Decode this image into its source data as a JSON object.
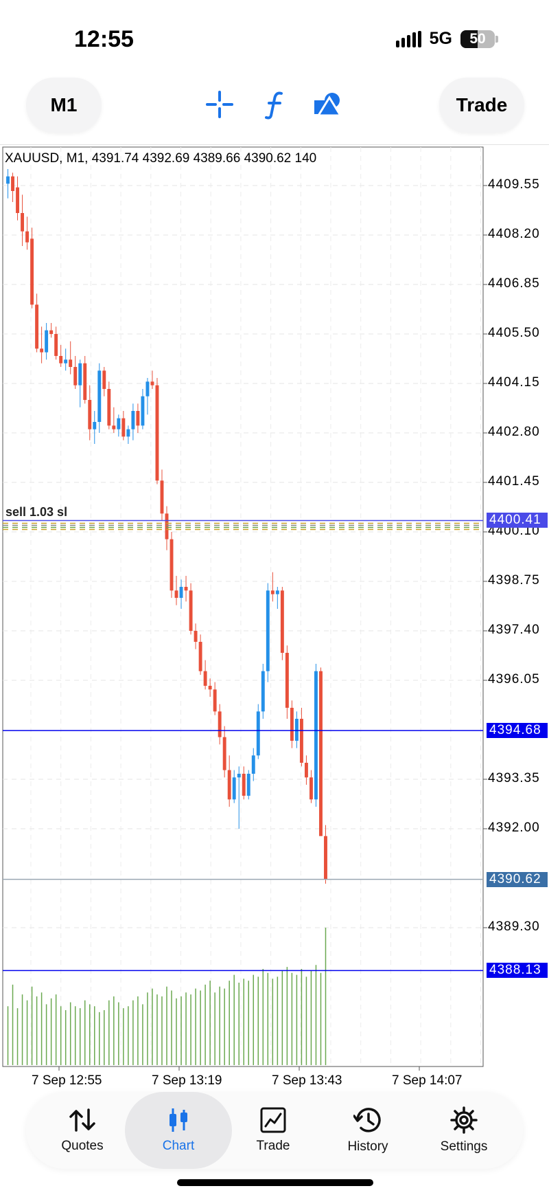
{
  "status_bar": {
    "time": "12:55",
    "network": "5G",
    "battery": "50",
    "battery_level": 0.5
  },
  "toolbar": {
    "timeframe": "M1",
    "trade_label": "Trade",
    "icons": [
      "crosshair-icon",
      "indicator-f-icon",
      "objects-icon"
    ]
  },
  "chart": {
    "header": "XAUUSD, M1, 4391.74 4392.69 4389.66 4390.62 140",
    "price_axis": [
      "4409.55",
      "4408.20",
      "4406.85",
      "4405.50",
      "4404.15",
      "4402.80",
      "4401.45",
      "4400.10",
      "4398.75",
      "4397.40",
      "4396.05",
      "4393.35",
      "4392.00",
      "4389.30"
    ],
    "time_axis": [
      "7 Sep 12:55",
      "7 Sep 13:19",
      "7 Sep 13:43",
      "7 Sep 14:07"
    ],
    "order_label": "sell 1.03 sl",
    "lines": {
      "sell_level": {
        "label": "4400.41",
        "color": "#4a4ae8"
      },
      "level_1": {
        "label": "4394.68",
        "color": "#0000ee"
      },
      "bid": {
        "label": "4390.62",
        "color": "#3a6fa6"
      },
      "level_2": {
        "label": "4388.13",
        "color": "#0000ee"
      }
    },
    "colors": {
      "bull": "#2490e8",
      "bear": "#e8503a",
      "volume": "#6aa84f"
    }
  },
  "chart_data": {
    "type": "candlestick",
    "symbol": "XAUUSD",
    "timeframe": "M1",
    "ylim": [
      4388.0,
      4410.0
    ],
    "x": [
      "12:55",
      "13:19",
      "13:43",
      "14:07"
    ],
    "last": {
      "open": 4391.74,
      "high": 4392.69,
      "low": 4389.66,
      "close": 4390.62,
      "volume": 140
    },
    "candles": [
      [
        4409.6,
        4410.0,
        4409.2,
        4409.8
      ],
      [
        4409.8,
        4409.9,
        4409.1,
        4409.4
      ],
      [
        4409.5,
        4409.8,
        4408.6,
        4408.8
      ],
      [
        4408.8,
        4409.3,
        4407.9,
        4408.3
      ],
      [
        4408.3,
        4408.7,
        4407.8,
        4408.0
      ],
      [
        4408.1,
        4408.4,
        4406.2,
        4406.3
      ],
      [
        4406.3,
        4406.6,
        4405.0,
        4405.1
      ],
      [
        4405.1,
        4405.7,
        4404.7,
        4405.0
      ],
      [
        4405.0,
        4405.8,
        4404.8,
        4405.6
      ],
      [
        4405.6,
        4405.8,
        4405.4,
        4405.5
      ],
      [
        4405.5,
        4405.7,
        4404.8,
        4404.9
      ],
      [
        4404.9,
        4405.2,
        4404.6,
        4404.7
      ],
      [
        4404.7,
        4405.1,
        4404.5,
        4404.8
      ],
      [
        4404.8,
        4405.3,
        4404.4,
        4404.6
      ],
      [
        4404.6,
        4404.9,
        4404.0,
        4404.1
      ],
      [
        4404.1,
        4404.8,
        4403.5,
        4404.7
      ],
      [
        4404.7,
        4404.9,
        4403.6,
        4403.7
      ],
      [
        4403.7,
        4404.1,
        4402.6,
        4402.9
      ],
      [
        4402.9,
        4403.4,
        4402.5,
        4403.1
      ],
      [
        4403.1,
        4404.7,
        4402.8,
        4404.5
      ],
      [
        4404.5,
        4404.6,
        4403.8,
        4404.0
      ],
      [
        4404.0,
        4404.2,
        4402.9,
        4403.0
      ],
      [
        4403.0,
        4403.5,
        4402.8,
        4402.9
      ],
      [
        4402.9,
        4403.3,
        4402.7,
        4403.2
      ],
      [
        4403.2,
        4403.4,
        4402.6,
        4402.7
      ],
      [
        4402.7,
        4403.0,
        4402.5,
        4402.9
      ],
      [
        4402.9,
        4403.6,
        4402.6,
        4403.4
      ],
      [
        4403.4,
        4403.6,
        4402.8,
        4403.0
      ],
      [
        4403.0,
        4404.0,
        4402.9,
        4403.8
      ],
      [
        4403.8,
        4404.3,
        4403.3,
        4404.2
      ],
      [
        4404.2,
        4404.5,
        4404.0,
        4404.1
      ],
      [
        4404.1,
        4404.3,
        4401.4,
        4401.5
      ],
      [
        4401.5,
        4401.8,
        4400.4,
        4400.6
      ],
      [
        4400.6,
        4400.8,
        4399.6,
        4399.9
      ],
      [
        4399.9,
        4400.1,
        4398.3,
        4398.5
      ],
      [
        4398.5,
        4398.9,
        4398.1,
        4398.3
      ],
      [
        4398.3,
        4398.8,
        4398.0,
        4398.6
      ],
      [
        4398.6,
        4398.9,
        4398.2,
        4398.5
      ],
      [
        4398.5,
        4398.7,
        4397.3,
        4397.4
      ],
      [
        4397.4,
        4397.6,
        4396.9,
        4397.1
      ],
      [
        4397.1,
        4397.3,
        4396.2,
        4396.3
      ],
      [
        4396.3,
        4396.6,
        4395.8,
        4395.9
      ],
      [
        4395.9,
        4396.1,
        4395.6,
        4395.8
      ],
      [
        4395.8,
        4396.0,
        4395.1,
        4395.2
      ],
      [
        4395.2,
        4395.4,
        4394.3,
        4394.5
      ],
      [
        4394.5,
        4394.8,
        4393.4,
        4393.6
      ],
      [
        4393.6,
        4394.0,
        4392.6,
        4392.8
      ],
      [
        4392.8,
        4393.6,
        4392.7,
        4393.4
      ],
      [
        4393.4,
        4393.7,
        4392.0,
        4393.5
      ],
      [
        4393.5,
        4393.7,
        4392.8,
        4392.9
      ],
      [
        4392.9,
        4393.6,
        4392.8,
        4393.5
      ],
      [
        4393.5,
        4394.2,
        4393.3,
        4394.0
      ],
      [
        4394.0,
        4395.4,
        4393.9,
        4395.2
      ],
      [
        4395.2,
        4396.5,
        4395.0,
        4396.3
      ],
      [
        4396.3,
        4398.7,
        4396.0,
        4398.5
      ],
      [
        4398.5,
        4399.0,
        4398.2,
        4398.4
      ],
      [
        4398.4,
        4398.6,
        4398.0,
        4398.5
      ],
      [
        4398.5,
        4398.6,
        4396.6,
        4396.8
      ],
      [
        4396.8,
        4397.0,
        4395.0,
        4395.3
      ],
      [
        4395.3,
        4395.5,
        4394.2,
        4394.4
      ],
      [
        4394.4,
        4395.2,
        4394.2,
        4395.0
      ],
      [
        4395.0,
        4395.3,
        4393.7,
        4393.8
      ],
      [
        4393.8,
        4394.0,
        4393.2,
        4393.4
      ],
      [
        4393.4,
        4393.6,
        4392.7,
        4392.8
      ],
      [
        4392.8,
        4396.5,
        4392.6,
        4396.3
      ],
      [
        4396.3,
        4396.4,
        4392.5,
        4391.8
      ],
      [
        4391.8,
        4392.1,
        4390.5,
        4390.62
      ]
    ],
    "volumes": [
      60,
      82,
      58,
      72,
      66,
      80,
      70,
      74,
      62,
      68,
      72,
      60,
      56,
      64,
      60,
      58,
      66,
      62,
      60,
      54,
      56,
      66,
      70,
      64,
      58,
      60,
      66,
      70,
      62,
      74,
      78,
      72,
      70,
      80,
      76,
      68,
      70,
      74,
      72,
      78,
      76,
      82,
      86,
      74,
      80,
      78,
      86,
      92,
      84,
      88,
      86,
      92,
      90,
      98,
      94,
      88,
      90,
      96,
      100,
      94,
      92,
      98,
      90,
      96,
      102,
      94,
      140
    ],
    "levels": [
      4400.41,
      4394.68,
      4390.62,
      4388.13
    ]
  },
  "bottom_nav": {
    "items": [
      {
        "label": "Quotes",
        "icon": "quotes-arrows-icon"
      },
      {
        "label": "Chart",
        "icon": "chart-candles-icon",
        "active": true
      },
      {
        "label": "Trade",
        "icon": "trade-chart-icon"
      },
      {
        "label": "History",
        "icon": "history-clock-icon"
      },
      {
        "label": "Settings",
        "icon": "settings-gear-icon"
      }
    ]
  }
}
